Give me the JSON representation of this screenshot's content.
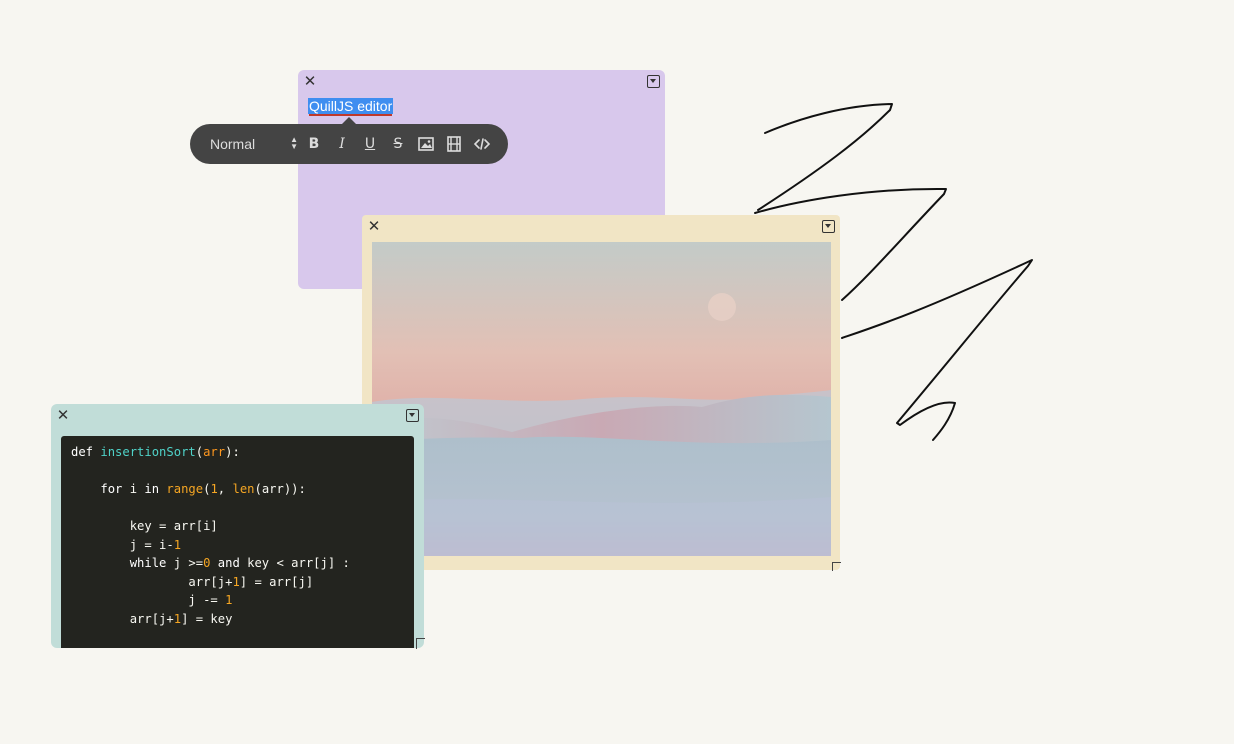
{
  "quill_card": {
    "text": "QuillJS editor",
    "close_icon": "close-icon",
    "menu_icon": "dropdown-icon",
    "background": "#d8c8ec"
  },
  "toolbar": {
    "format_select": "Normal",
    "buttons": [
      "bold-icon",
      "italic-icon",
      "underline-icon",
      "strikethrough-icon",
      "image-icon",
      "video-icon",
      "code-icon"
    ]
  },
  "image_card": {
    "background": "#f1e5c5",
    "image": "desert-dunes-sunset-photo"
  },
  "code_card": {
    "background": "#c1ddd8",
    "code_lines": [
      "def insertionSort(arr):",
      "",
      "    for i in range(1, len(arr)):",
      "",
      "        key = arr[i]",
      "        j = i-1",
      "        while j >=0 and key < arr[j] :",
      "                arr[j+1] = arr[j]",
      "                j -= 1",
      "        arr[j+1] = key"
    ]
  },
  "drawing": {
    "stroke_color": "#111111"
  }
}
